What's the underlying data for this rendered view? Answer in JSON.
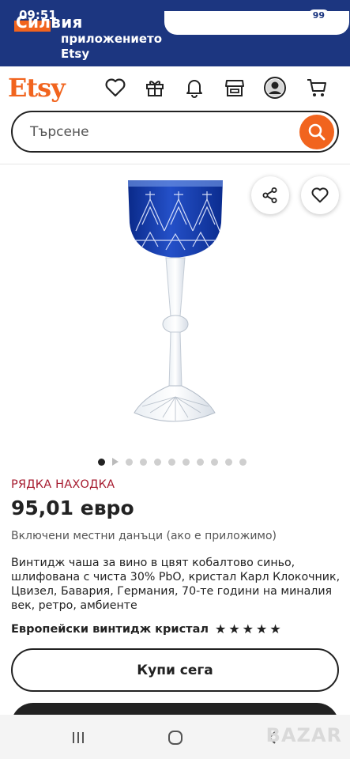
{
  "status_bar": {
    "time": "09:51",
    "battery": "99"
  },
  "promo": {
    "name": "Силвия",
    "line2": "приложението",
    "line3": "Etsy"
  },
  "header": {
    "logo": "Etsy",
    "icons": [
      "heart-icon",
      "gift-icon",
      "bell-icon",
      "shop-icon",
      "account-icon",
      "cart-icon"
    ]
  },
  "search": {
    "placeholder": "Търсене"
  },
  "gallery": {
    "image_count": 11,
    "active_index": 0
  },
  "product": {
    "badge": "РЯДКА НАХОДКА",
    "price": "95,01 евро",
    "tax_note": "Включени местни данъци (ако е приложимо)",
    "title": "Винтидж чаша за вино в цвят кобалтово синьо, шлифована с чиста 30% PbO, кристал Карл Клокочник, Цвизел, Бавария, Германия, 70-те години на миналия век, ретро, амбиенте",
    "shop_name": "Европейски винтидж кристал",
    "rating_stars": 5
  },
  "actions": {
    "buy_now": "Купи сега"
  },
  "watermark": "BAZAR",
  "colors": {
    "brand_orange": "#f1641e",
    "promo_blue": "#1c3680",
    "badge_red": "#a61a2e"
  }
}
